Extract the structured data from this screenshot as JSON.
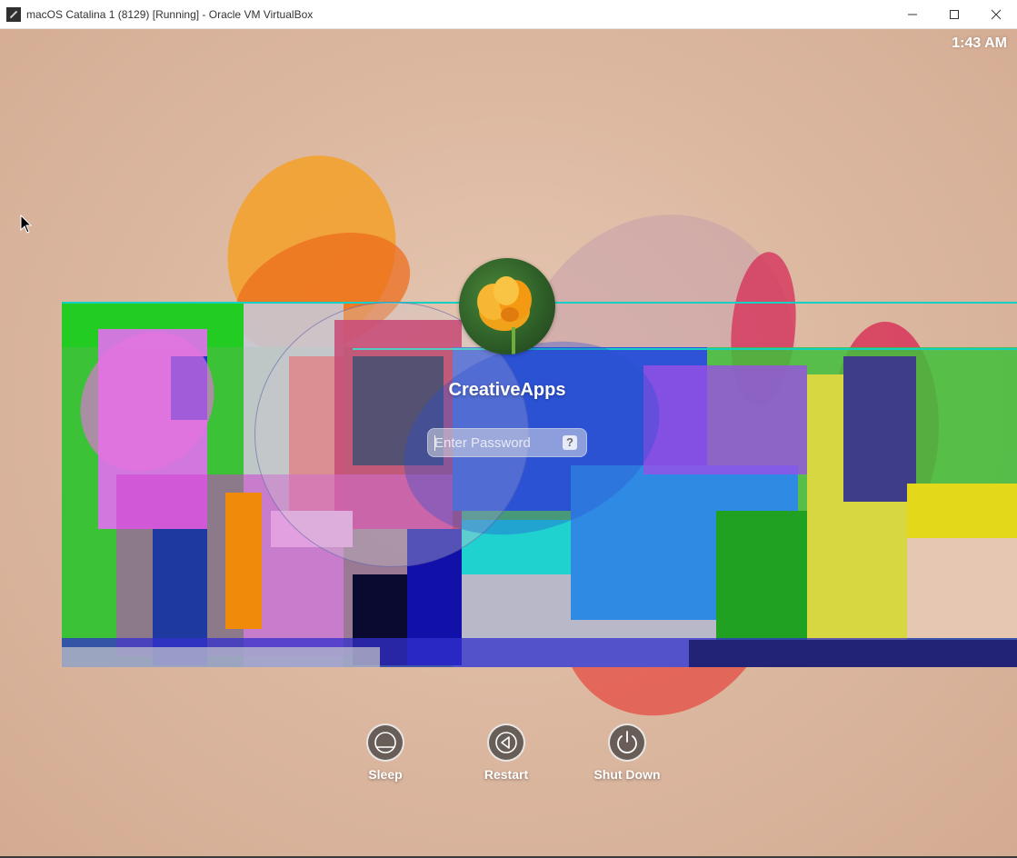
{
  "window": {
    "title": "macOS Catalina 1 (8129) [Running] - Oracle VM VirtualBox",
    "icon": "virtualbox-icon",
    "controls": [
      "minimize-icon",
      "maximize-icon",
      "close-icon"
    ]
  },
  "lockscreen": {
    "clock": "1:43 AM",
    "user": {
      "name": "CreativeApps",
      "avatar": "poppy-flower-avatar"
    },
    "password": {
      "placeholder": "Enter Password",
      "value": "",
      "hint_label": "?"
    },
    "actions": [
      {
        "label": "Sleep",
        "icon": "sleep-icon"
      },
      {
        "label": "Restart",
        "icon": "restart-icon"
      },
      {
        "label": "Shut Down",
        "icon": "power-icon"
      }
    ]
  },
  "colors": {
    "wallpaper": "#ddb9a2",
    "accent_orange": "#f3962e",
    "accent_red": "#d8374f",
    "glitch_green": "#19d21c",
    "glitch_blue": "#2d3fd8"
  }
}
